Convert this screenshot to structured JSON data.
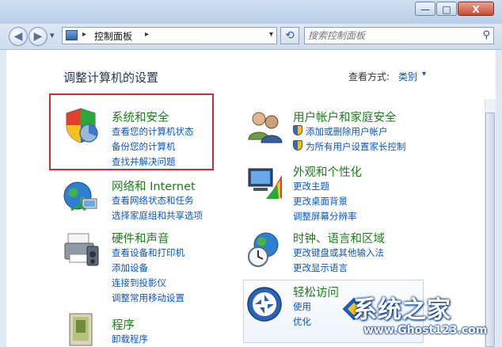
{
  "window": {
    "minimize_glyph": "—",
    "maximize_glyph": "□",
    "close_glyph": "X"
  },
  "nav": {
    "back_glyph": "◀",
    "forward_glyph": "▶",
    "history_glyph": "▾",
    "separator_glyph": "▸",
    "address_path": "控制面板",
    "address_dropdown_glyph": "▾",
    "refresh_glyph": "⟲",
    "search_placeholder": "搜索控制面板",
    "search_glyph": "⚲"
  },
  "header": {
    "title": "调整计算机的设置",
    "view_by_label": "查看方式:",
    "view_by_value": "类别",
    "view_by_arrow": "▾"
  },
  "categories": [
    {
      "title": "系统和安全",
      "links": [
        "查看您的计算机状态",
        "备份您的计算机",
        "查找并解决问题"
      ],
      "icon": "shield-icon"
    },
    {
      "title": "网络和 Internet",
      "links": [
        "查看网络状态和任务",
        "选择家庭组和共享选项"
      ],
      "icon": "network-globe-icon"
    },
    {
      "title": "硬件和声音",
      "links": [
        "查看设备和打印机",
        "添加设备",
        "连接到投影仪",
        "调整常用移动设置"
      ],
      "icon": "printer-icon"
    },
    {
      "title": "程序",
      "links": [
        "卸载程序"
      ],
      "icon": "programs-icon"
    },
    {
      "title": "用户帐户和家庭安全",
      "links": [
        "添加或删除用户帐户",
        "为所有用户设置家长控制"
      ],
      "icon": "users-icon"
    },
    {
      "title": "外观和个性化",
      "links": [
        "更改主题",
        "更改桌面背景",
        "调整屏幕分辨率"
      ],
      "icon": "monitor-palette-icon"
    },
    {
      "title": "时钟、语言和区域",
      "links": [
        "更改键盘或其他输入法",
        "更改显示语言"
      ],
      "icon": "clock-globe-icon"
    },
    {
      "title": "轻松访问",
      "links": [
        "使用",
        "优化"
      ],
      "icon": "ease-of-access-icon"
    }
  ],
  "watermark": {
    "title": "系统之家",
    "url": "www.Ghost123.com"
  },
  "colors": {
    "category_title": "#1d7d1d",
    "link": "#0b56c0",
    "highlight_border": "#d9272e"
  }
}
